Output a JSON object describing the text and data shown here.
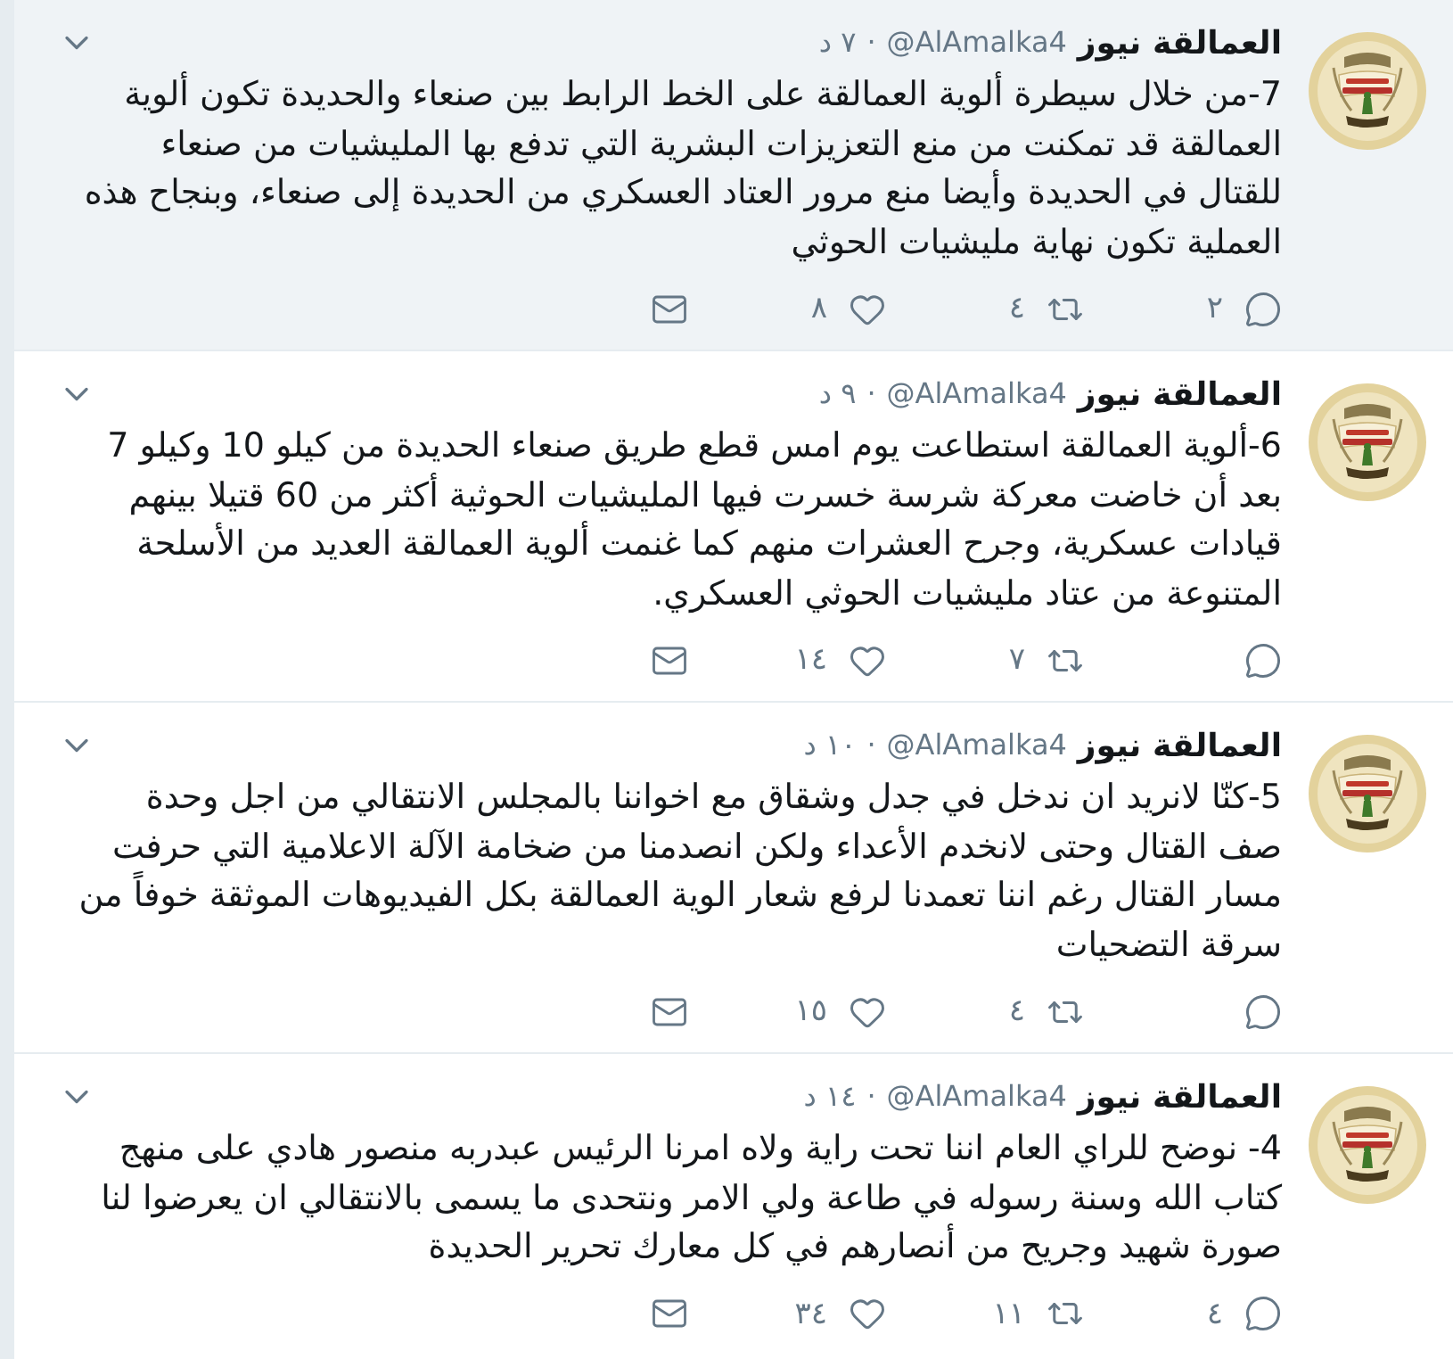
{
  "tweets": [
    {
      "highlighted": true,
      "author": {
        "name": "العمالقة نيوز",
        "handle": "@AlAmalka4"
      },
      "separator": "·",
      "time": "٧ د",
      "text": "7-من خلال سيطرة ألوية العمالقة على الخط الرابط بين صنعاء والحديدة تكون ألوية العمالقة قد تمكنت من منع التعزيزات البشرية التي تدفع بها المليشيات من صنعاء للقتال في الحديدة وأيضا منع مرور العتاد العسكري من الحديدة إلى صنعاء، وبنجاح هذه العملية تكون نهاية مليشيات الحوثي",
      "actions": [
        {
          "kind": "reply",
          "count": "٢"
        },
        {
          "kind": "retweet",
          "count": "٤"
        },
        {
          "kind": "like",
          "count": "٨"
        },
        {
          "kind": "message"
        }
      ]
    },
    {
      "highlighted": false,
      "author": {
        "name": "العمالقة نيوز",
        "handle": "@AlAmalka4"
      },
      "separator": "·",
      "time": "٩ د",
      "text": "6-ألوية العمالقة استطاعت يوم امس قطع طريق صنعاء الحديدة من كيلو 10 وكيلو 7 بعد أن خاضت معركة شرسة خسرت فيها المليشيات الحوثية أكثر من 60 قتيلا بينهم قيادات عسكرية، وجرح العشرات منهم كما غنمت ألوية العمالقة العديد من الأسلحة المتنوعة من عتاد مليشيات الحوثي العسكري.",
      "actions": [
        {
          "kind": "reply"
        },
        {
          "kind": "retweet",
          "count": "٧"
        },
        {
          "kind": "like",
          "count": "١٤"
        },
        {
          "kind": "message"
        }
      ]
    },
    {
      "highlighted": false,
      "author": {
        "name": "العمالقة نيوز",
        "handle": "@AlAmalka4"
      },
      "separator": "·",
      "time": "١٠ د",
      "text": "5-كنّا لانريد ان ندخل في جدل وشقاق مع اخواننا بالمجلس الانتقالي من اجل وحدة صف القتال وحتى لانخدم الأعداء ولكن انصدمنا من ضخامة الآلة الاعلامية التي حرفت مسار القتال رغم اننا تعمدنا لرفع شعار الوية العمالقة بكل الفيديوهات الموثقة خوفاً من سرقة التضحيات",
      "actions": [
        {
          "kind": "reply"
        },
        {
          "kind": "retweet",
          "count": "٤"
        },
        {
          "kind": "like",
          "count": "١٥"
        },
        {
          "kind": "message"
        }
      ]
    },
    {
      "highlighted": false,
      "author": {
        "name": "العمالقة نيوز",
        "handle": "@AlAmalka4"
      },
      "separator": "·",
      "time": "١٤ د",
      "text": "4- نوضح للراي العام اننا تحت راية ولاه امرنا الرئيس عبدربه منصور هادي على منهج كتاب الله وسنة رسوله في طاعة ولي الامر ونتحدى ما يسمى بالانتقالي ان يعرضوا لنا صورة شهيد وجريح من أنصارهم في كل معارك تحرير الحديدة",
      "actions": [
        {
          "kind": "reply",
          "count": "٤"
        },
        {
          "kind": "retweet",
          "count": "١١"
        },
        {
          "kind": "like",
          "count": "٣٤"
        },
        {
          "kind": "message"
        }
      ]
    }
  ]
}
